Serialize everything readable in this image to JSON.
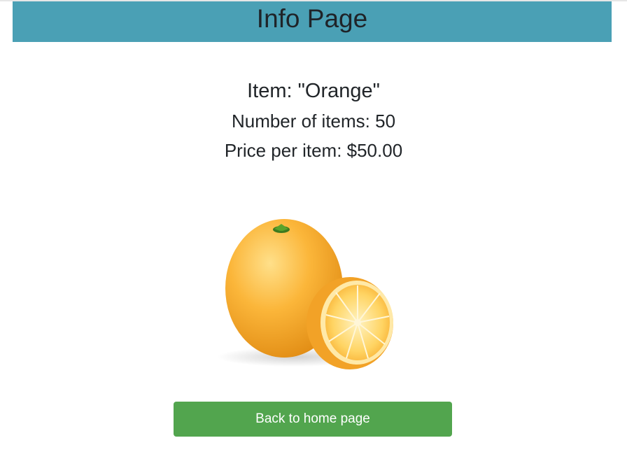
{
  "header": {
    "title": "Info Page"
  },
  "item": {
    "name_line": "Item: \"Orange\"",
    "count_line": "Number of items: 50",
    "price_line": "Price per item: $50.00"
  },
  "image": {
    "subject": "orange-with-half"
  },
  "actions": {
    "back_label": "Back to home page"
  },
  "colors": {
    "header_bg": "#4aa0b5",
    "button_bg": "#52a54e",
    "orange": "#f5a623"
  }
}
